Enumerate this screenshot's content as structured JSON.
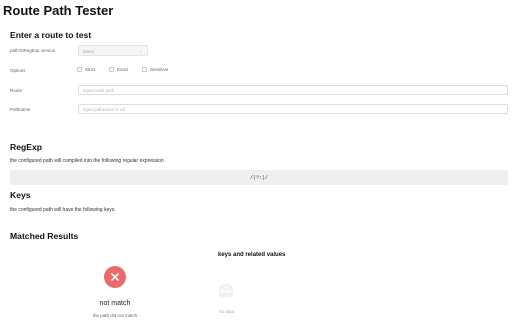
{
  "page": {
    "title": "Route Path Tester"
  },
  "form": {
    "heading": "Enter a route to test",
    "version": {
      "label": "pathToRegExp version",
      "value": "latest"
    },
    "options": {
      "label": "Options",
      "items": [
        {
          "label": "Strict",
          "checked": false
        },
        {
          "label": "Exact",
          "checked": false
        },
        {
          "label": "Sensitive",
          "checked": false
        }
      ]
    },
    "route": {
      "label": "Route",
      "placeholder": "input route path",
      "value": ""
    },
    "pathname": {
      "label": "Pathname",
      "placeholder": "input pathname in url",
      "value": ""
    }
  },
  "regexp": {
    "heading": "RegExp",
    "description": "the configured path will compiled into the following regular expression",
    "value": "/(?:)/"
  },
  "keys": {
    "heading": "Keys",
    "description": "the configured path will have the following keys."
  },
  "results": {
    "heading": "Matched Results",
    "status_icon": "close-icon",
    "status": "not match",
    "status_detail": "the path did not match",
    "kv_heading": "keys and related values",
    "empty_label": "no data"
  },
  "colors": {
    "error": "#ec6a6a",
    "code_background": "#efefef"
  }
}
